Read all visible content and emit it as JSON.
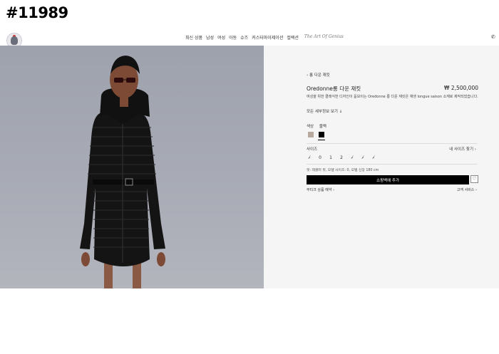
{
  "tag": "#11989",
  "header": {
    "nav": [
      "최신 상품",
      "남성",
      "여성",
      "아동",
      "슈즈",
      "커스터마이제이션",
      "컬렉션"
    ],
    "tagline": "The Art Of Genius",
    "logo_icon": "brand-logo-icon",
    "phone_icon": "phone-icon"
  },
  "photo": {
    "background": "#a6a9b3",
    "coat_color": "#141414"
  },
  "product": {
    "back_link": "‹ 롱 다운 재킷",
    "title": "Oredonne롱 다운 재킷",
    "price": "₩ 2,500,000",
    "description": "여성을 위한 클래식한 디자인이 돋보이는 Oredonne 롱 다운 재킷은 재생 longue saison 소재로 제작되었습니다.",
    "details_link": "모든 세부정보 보기 ↓",
    "color_label": "색상",
    "color_value": "블랙",
    "swatches": [
      "#b7a99d",
      "#000000"
    ],
    "size_label": "사이즈",
    "size_guide": "내 사이즈 찾기 ›",
    "sizes": [
      "00",
      "0",
      "1",
      "2",
      "3",
      "4",
      "5"
    ],
    "sizes_available": [
      false,
      true,
      true,
      true,
      false,
      false,
      false
    ],
    "fit_note": "핏: 레귤러 핏, 모델 사이즈: 0, 모델 신장 180 cm",
    "add_to_cart": "쇼핑백에 추가",
    "wishlist_icon": "heart-icon",
    "store_link": "부티크 상품 예약 ›",
    "service_link": "고객 서비스 ›"
  }
}
